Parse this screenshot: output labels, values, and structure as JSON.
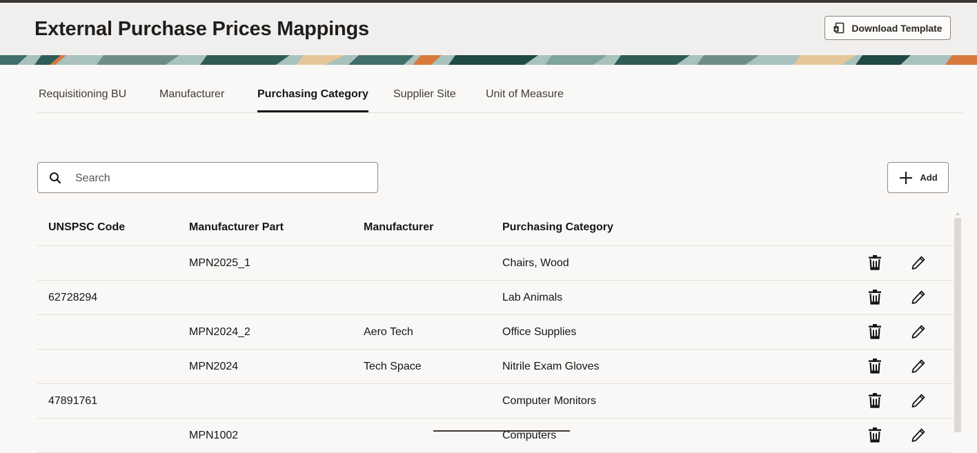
{
  "header": {
    "title": "External Purchase Prices Mappings",
    "download_label": "Download Template"
  },
  "tabs": [
    {
      "label": "Requisitioning BU",
      "active": false
    },
    {
      "label": "Manufacturer",
      "active": false
    },
    {
      "label": "Purchasing Category",
      "active": true
    },
    {
      "label": "Supplier Site",
      "active": false
    },
    {
      "label": "Unit of Measure",
      "active": false
    }
  ],
  "search": {
    "placeholder": "Search",
    "value": ""
  },
  "add": {
    "label": "Add"
  },
  "table": {
    "columns": [
      "UNSPSC Code",
      "Manufacturer Part",
      "Manufacturer",
      "Purchasing Category"
    ],
    "rows": [
      {
        "unspsc": "",
        "part": "MPN2025_1",
        "manufacturer": "",
        "category": "Chairs, Wood"
      },
      {
        "unspsc": "62728294",
        "part": "",
        "manufacturer": "",
        "category": "Lab Animals"
      },
      {
        "unspsc": "",
        "part": "MPN2024_2",
        "manufacturer": "Aero Tech",
        "category": "Office Supplies"
      },
      {
        "unspsc": "",
        "part": "MPN2024",
        "manufacturer": "Tech Space",
        "category": "Nitrile Exam Gloves"
      },
      {
        "unspsc": "47891761",
        "part": "",
        "manufacturer": "",
        "category": "Computer Monitors"
      },
      {
        "unspsc": "",
        "part": "MPN1002",
        "manufacturer": "",
        "category": "Computers"
      }
    ],
    "row_actions": [
      "trash-icon",
      "pencil-icon"
    ]
  },
  "colors": {
    "accent_text": "#161513",
    "header_bg": "#f1efed",
    "banner_teal": "#5f8f8a",
    "banner_orange": "#d87a3e"
  }
}
